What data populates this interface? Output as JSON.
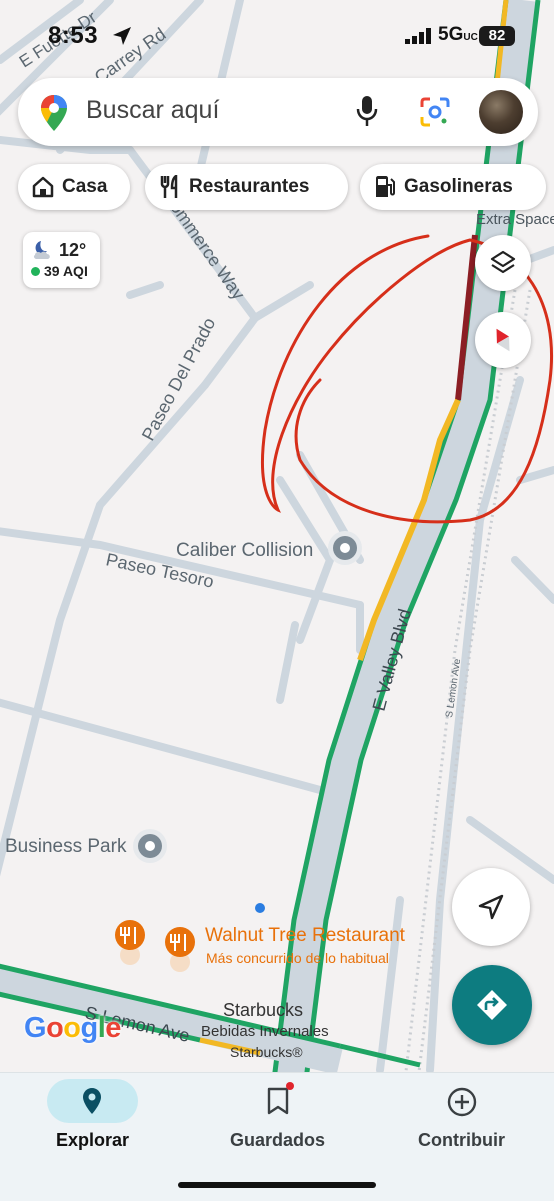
{
  "status_bar": {
    "time": "8:53",
    "network": "5G",
    "network_suffix": "UC",
    "battery": "82"
  },
  "search": {
    "placeholder": "Buscar aquí",
    "icons": [
      "maps-pin-icon",
      "mic-icon",
      "lens-icon",
      "avatar"
    ]
  },
  "chips": [
    {
      "label": "Casa",
      "icon": "home-icon"
    },
    {
      "label": "Restaurantes",
      "icon": "fork-knife-icon"
    },
    {
      "label": "Gasolineras",
      "icon": "gas-pump-icon"
    }
  ],
  "weather": {
    "temp": "12°",
    "aqi": "39 AQI",
    "aqi_color": "#21b35b",
    "icon": "moon-cloud-icon"
  },
  "map_labels": {
    "street_fuerte": "E Fuerte Dr",
    "street_carrey": "Carrey Rd",
    "street_commerce": "Commerce Way",
    "street_prado": "Paseo Del Prado",
    "street_tesoro": "Paseo Tesoro",
    "street_valley": "E Valley Blvd",
    "street_lemon_ave": "S Lemon Ave",
    "street_lemon_ave_small": "S Lemon Ave",
    "extra_space": "Extra Space",
    "caliber": "Caliber Collision",
    "business_park": "Business Park",
    "walnut_name": "Walnut Tree Restaurant",
    "walnut_status": "Más concurrido de lo habitual",
    "starbucks_name": "Starbucks",
    "starbucks_sub1": "Bebidas Invernales",
    "starbucks_sub2": "Starbucks®",
    "google_logo": "Google"
  },
  "colors": {
    "traffic_green": "#1fa463",
    "traffic_yellow": "#f2b824",
    "traffic_red": "#8b1e24",
    "annotation_red": "#d62f1a",
    "restaurant_orange": "#e8710a",
    "accent_teal": "#0d7c80"
  },
  "map_controls": [
    "layers-icon",
    "compass-icon",
    "my-location-icon",
    "directions-icon"
  ],
  "bottom_nav": [
    {
      "label": "Explorar",
      "icon": "explore-pin-icon",
      "active": true
    },
    {
      "label": "Guardados",
      "icon": "bookmark-icon",
      "badge": true
    },
    {
      "label": "Contribuir",
      "icon": "add-circle-icon"
    }
  ]
}
